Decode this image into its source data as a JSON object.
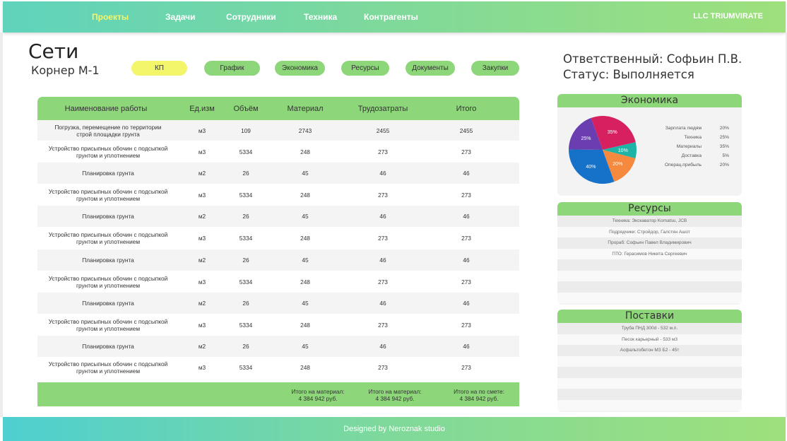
{
  "nav": {
    "items": [
      {
        "label": "Проекты",
        "active": true
      },
      {
        "label": "Задачи",
        "active": false
      },
      {
        "label": "Сотрудники",
        "active": false
      },
      {
        "label": "Техника",
        "active": false
      },
      {
        "label": "Контрагенты",
        "active": false
      }
    ],
    "brand": "LLC TRIUMVIRATE"
  },
  "project": {
    "title": "Сети",
    "subtitle": "Корнер М-1",
    "responsible": "Ответственный: Софьин П.В.",
    "status": "Статус: Выполняется"
  },
  "tabs": [
    {
      "label": "КП",
      "active": true
    },
    {
      "label": "График",
      "active": false
    },
    {
      "label": "Экономика",
      "active": false
    },
    {
      "label": "Ресурсы",
      "active": false
    },
    {
      "label": "Документы",
      "active": false
    },
    {
      "label": "Закупки",
      "active": false
    }
  ],
  "table": {
    "headers": [
      "Наименование работы",
      "Ед.изм",
      "Объём",
      "Материал",
      "Трудозатраты",
      "Итого"
    ],
    "rows": [
      {
        "name": [
          "Погрузка, перемещение по территории",
          "строй площадки грунта"
        ],
        "unit": "м3",
        "volume": "109",
        "material": "2743",
        "labor": "2455",
        "total": "2455"
      },
      {
        "name": [
          "Устройство присыпных обочин с подсыпкой",
          "грунтом и уплотнением"
        ],
        "unit": "м3",
        "volume": "5334",
        "material": "248",
        "labor": "273",
        "total": "273"
      },
      {
        "name": [
          "Планировка грунта"
        ],
        "unit": "м2",
        "volume": "26",
        "material": "45",
        "labor": "46",
        "total": "46"
      },
      {
        "name": [
          "Устройство присыпных обочин с подсыпкой",
          "грунтом и уплотнением"
        ],
        "unit": "м3",
        "volume": "5334",
        "material": "248",
        "labor": "273",
        "total": "273"
      },
      {
        "name": [
          "Планировка грунта"
        ],
        "unit": "м2",
        "volume": "26",
        "material": "45",
        "labor": "46",
        "total": "46"
      },
      {
        "name": [
          "Устройство присыпных обочин с подсыпкой",
          "грунтом и уплотнением"
        ],
        "unit": "м3",
        "volume": "5334",
        "material": "248",
        "labor": "273",
        "total": "273"
      },
      {
        "name": [
          "Планировка грунта"
        ],
        "unit": "м2",
        "volume": "26",
        "material": "45",
        "labor": "46",
        "total": "46"
      },
      {
        "name": [
          "Устройство присыпных обочин с подсыпкой",
          "грунтом и уплотнением"
        ],
        "unit": "м3",
        "volume": "5334",
        "material": "248",
        "labor": "273",
        "total": "273"
      },
      {
        "name": [
          "Планировка грунта"
        ],
        "unit": "м2",
        "volume": "26",
        "material": "45",
        "labor": "46",
        "total": "46"
      },
      {
        "name": [
          "Устройство присыпных обочин с подсыпкой",
          "грунтом и уплотнением"
        ],
        "unit": "м3",
        "volume": "5334",
        "material": "248",
        "labor": "273",
        "total": "273"
      },
      {
        "name": [
          "Планировка грунта"
        ],
        "unit": "м2",
        "volume": "26",
        "material": "45",
        "labor": "46",
        "total": "46"
      },
      {
        "name": [
          "Устройство присыпных обочин с подсыпкой",
          "грунтом и уплотнением"
        ],
        "unit": "м3",
        "volume": "5334",
        "material": "248",
        "labor": "273",
        "total": "273"
      }
    ],
    "totals": [
      {
        "label": "Итого на материал:",
        "value": "4 384 942 руб."
      },
      {
        "label": "Итого на материал:",
        "value": "4 384 942 руб."
      },
      {
        "label": "Итого на по смете:",
        "value": "4 384 942 руб."
      }
    ]
  },
  "economics": {
    "title": "Экономика",
    "legend": [
      {
        "name": "Зарплата людям",
        "value": "20%"
      },
      {
        "name": "Техника",
        "value": "25%"
      },
      {
        "name": "Материалы",
        "value": "35%"
      },
      {
        "name": "Доставка",
        "value": "5%"
      },
      {
        "name": "Операц.прибыль",
        "value": "20%"
      }
    ]
  },
  "chart_data": {
    "type": "pie",
    "slices": [
      {
        "value": 35,
        "label": "35%",
        "color": "#d6205f"
      },
      {
        "value": 10,
        "label": "10%",
        "color": "#1fb3a5"
      },
      {
        "value": 20,
        "label": "20%",
        "color": "#f58a3e"
      },
      {
        "value": 40,
        "label": "40%",
        "color": "#1672c9"
      },
      {
        "value": 25,
        "label": "25%",
        "color": "#6a3db0"
      }
    ]
  },
  "resources": {
    "title": "Ресурсы",
    "items": [
      "Техника: Экскаватор Komatsu, JCB",
      "Подрядчики: Стройдор, Галстян Ашот",
      "Прораб: Софьин Павел Владимирович",
      "ПТО: Герасимов Никита Сергеевич"
    ]
  },
  "supplies": {
    "title": "Поставки",
    "items": [
      "Труба ПНД 300d - 532 м.п.",
      "Песок карьерный - 533 м3",
      "Асфальтобетон МЗ Б2 - 45т"
    ]
  },
  "footer": {
    "text": "Designed by Neroznak studio"
  },
  "colors": {
    "accent_green": "#8ed67a",
    "active_yellow": "#f3f56b",
    "active_nav": "#f6f56a"
  }
}
